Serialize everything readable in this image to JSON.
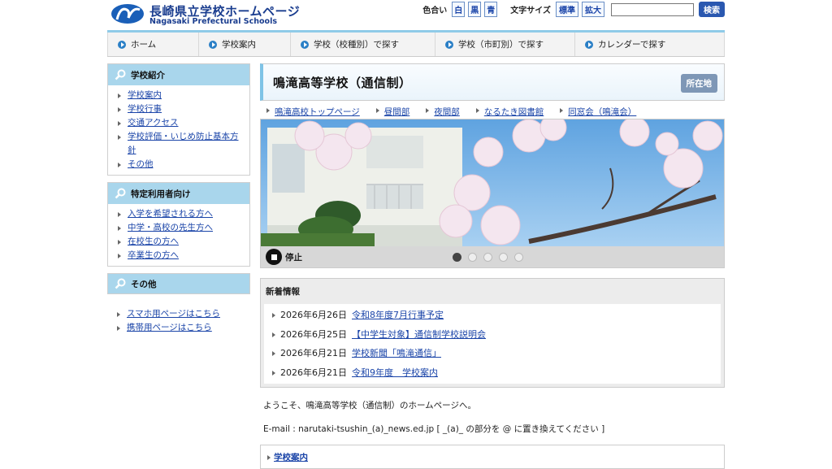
{
  "header": {
    "title": "長崎県立学校ホームページ",
    "subtitle": "Nagasaki Prefectural Schools",
    "color_label": "色合い",
    "color_options": [
      "白",
      "黒",
      "青"
    ],
    "font_size_label": "文字サイズ",
    "font_size_options": [
      "標準",
      "拡大"
    ],
    "search_value": "",
    "search_button": "検索"
  },
  "nav": {
    "items": [
      "ホーム",
      "学校案内",
      "学校（校種別）で探す",
      "学校（市町別）で探す",
      "カレンダーで探す"
    ]
  },
  "sidebar": {
    "section1": {
      "title": "学校紹介",
      "items": [
        "学校案内",
        "学校行事",
        "交通アクセス",
        "学校評価・いじめ防止基本方針",
        "その他"
      ]
    },
    "section2": {
      "title": "特定利用者向け",
      "items": [
        "入学を希望される方へ",
        "中学・高校の先生方へ",
        "在校生の方へ",
        "卒業生の方へ"
      ]
    },
    "section3": {
      "title": "その他",
      "items": [
        "スマホ用ページはこちら",
        "携帯用ページはこちら"
      ]
    }
  },
  "main": {
    "page_title": "鳴滝高等学校（通信制）",
    "location_button": "所在地",
    "sub_nav": [
      "鳴滝高校トップページ",
      "昼間部",
      "夜間部",
      "なるたき図書館",
      "同窓会（鳴滝会）"
    ],
    "slider": {
      "stop_label": "停止",
      "slide_count": 5,
      "active_index": 0
    },
    "news": {
      "title": "新着情報",
      "items": [
        {
          "date": "2026年6月26日",
          "text": "令和8年度7月行事予定"
        },
        {
          "date": "2026年6月25日",
          "text": "【中学生対象】通信制学校説明会"
        },
        {
          "date": "2026年6月21日",
          "text": "学校新聞「鳴滝通信」"
        },
        {
          "date": "2026年6月21日",
          "text": "令和9年度　学校案内"
        }
      ]
    },
    "welcome": "ようこそ、鳴滝高等学校（通信制）のホームページへ。",
    "email": "E-mail : narutaki-tsushin_(a)_news.ed.jp [ _(a)_ の部分を @ に置き換えてください ]",
    "bottom_link": "学校案内"
  },
  "colors": {
    "brand_blue": "#1a3d8f",
    "nav_accent": "#8fcbe8",
    "side_head": "#a9d6ec",
    "link": "#1a44a8"
  }
}
